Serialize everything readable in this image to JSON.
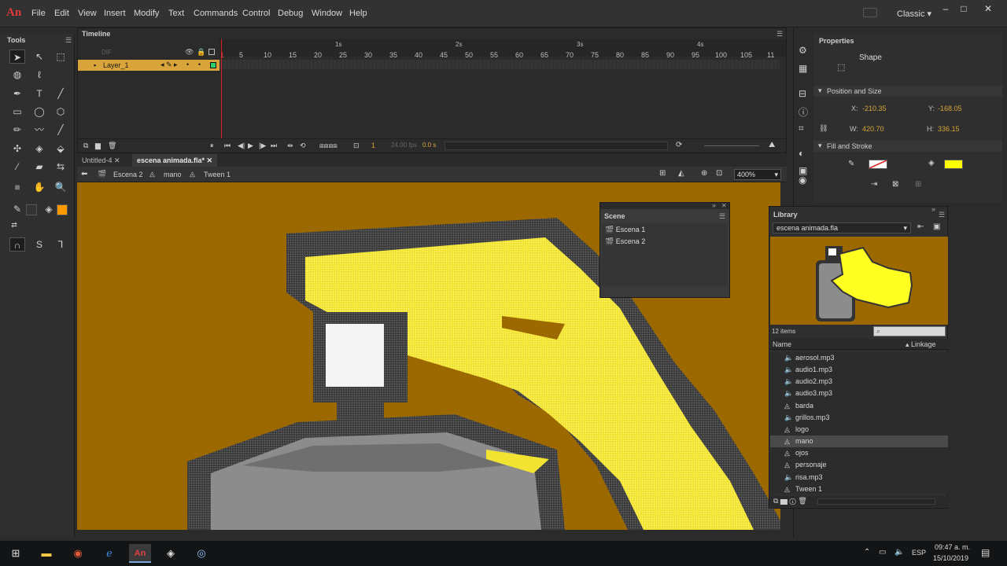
{
  "app": {
    "logo": "An",
    "workspace": "Classic"
  },
  "menu": [
    "File",
    "Edit",
    "View",
    "Insert",
    "Modify",
    "Text",
    "Commands",
    "Control",
    "Debug",
    "Window",
    "Help"
  ],
  "tools": {
    "title": "Tools"
  },
  "timeline": {
    "title": "Timeline",
    "layer_name": "Layer_1",
    "seconds": [
      "1s",
      "2s",
      "3s",
      "4s"
    ],
    "frames": [
      "1",
      "5",
      "10",
      "15",
      "20",
      "25",
      "30",
      "35",
      "40",
      "45",
      "50",
      "55",
      "60",
      "65",
      "70",
      "75",
      "80",
      "85",
      "90",
      "95",
      "100",
      "105",
      "11"
    ],
    "current_frame": "1",
    "fps": "24.00 fps",
    "elapsed": "0.0 s"
  },
  "doc_tabs": [
    {
      "label": "Untitled-4"
    },
    {
      "label": "escena animada.fla*"
    }
  ],
  "editbar": {
    "scene": "Escena 2",
    "symbol": "mano",
    "tween": "Tween 1",
    "zoom": "400%"
  },
  "scene_panel": {
    "title": "Scene",
    "items": [
      "Escena 1",
      "Escena 2"
    ]
  },
  "properties": {
    "title": "Properties",
    "type": "Shape",
    "section_position": "Position and Size",
    "x_label": "X:",
    "x_value": "-210.35",
    "y_label": "Y:",
    "y_value": "-168.05",
    "w_label": "W:",
    "w_value": "420.70",
    "h_label": "H:",
    "h_value": "336.15",
    "section_fill": "Fill and Stroke",
    "fill_color": "#ffff00"
  },
  "library": {
    "title": "Library",
    "document": "escena animada.fla",
    "count": "12 items",
    "col_name": "Name",
    "col_linkage": "Linkage",
    "items": [
      {
        "name": "aerosol.mp3",
        "icon": "sound-icon"
      },
      {
        "name": "audio1.mp3",
        "icon": "sound-icon"
      },
      {
        "name": "audio2.mp3",
        "icon": "sound-icon"
      },
      {
        "name": "audio3.mp3",
        "icon": "sound-icon"
      },
      {
        "name": "barda",
        "icon": "graphic-icon"
      },
      {
        "name": "grillos.mp3",
        "icon": "sound-icon"
      },
      {
        "name": "logo",
        "icon": "graphic-icon"
      },
      {
        "name": "mano",
        "icon": "graphic-icon",
        "selected": true
      },
      {
        "name": "ojos",
        "icon": "graphic-icon"
      },
      {
        "name": "personaje",
        "icon": "graphic-icon"
      },
      {
        "name": "risa.mp3",
        "icon": "sound-icon"
      },
      {
        "name": "Tween 1",
        "icon": "graphic-icon"
      }
    ]
  },
  "taskbar": {
    "lang": "ESP",
    "time": "09:47 a. m.",
    "date": "15/10/2019"
  },
  "colors": {
    "stage": "#9c6800",
    "fill_yellow": "#ffff33",
    "outline": "#333333",
    "layer_highlight": "#d9a43a"
  }
}
